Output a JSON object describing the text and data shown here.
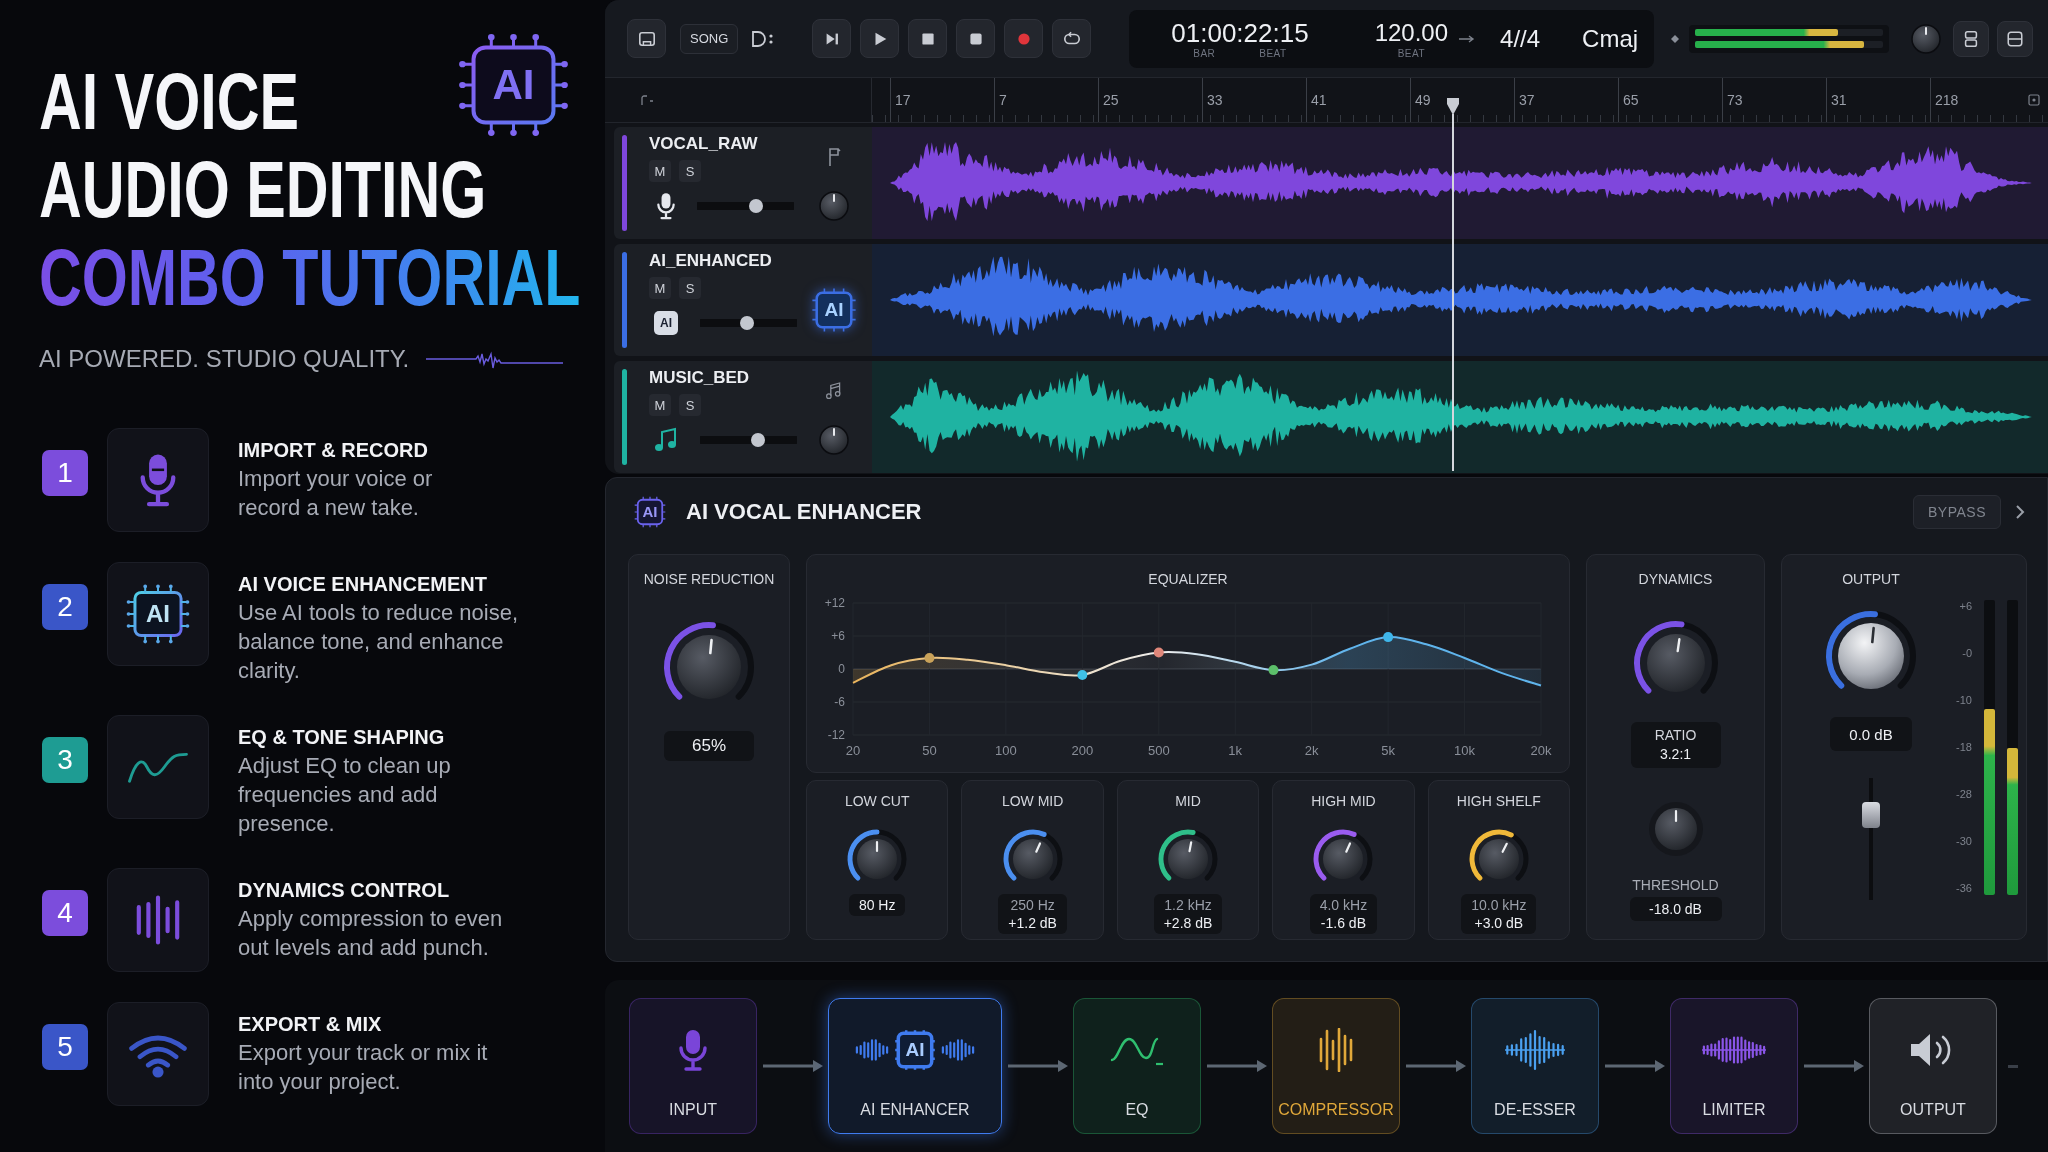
{
  "hero": {
    "chip_text": "AI",
    "title_lines": [
      {
        "text": "AI VOICE",
        "kind": "plain"
      },
      {
        "text": "AUDIO EDITING",
        "kind": "plain"
      },
      {
        "text": "COMBO TUTORIAL",
        "kind": "gradient"
      }
    ],
    "tagline": "AI POWERED. STUDIO QUALITY."
  },
  "steps": [
    {
      "number": "1",
      "color": "#7c4ddc",
      "title": "IMPORT & RECORD",
      "description": "Import your voice or\nrecord a new take."
    },
    {
      "number": "2",
      "color": "#3a56c8",
      "title": "AI VOICE ENHANCEMENT",
      "description": "Use AI tools to reduce noise,\nbalance tone, and enhance\nclarity.",
      "chip_text": "AI"
    },
    {
      "number": "3",
      "color": "#1e9c93",
      "title": "EQ & TONE SHAPING",
      "description": "Adjust EQ to clean up\nfrequencies and add\npresence."
    },
    {
      "number": "4",
      "color": "#7c4ddc",
      "title": "DYNAMICS CONTROL",
      "description": "Apply compression to even\nout levels and add punch."
    },
    {
      "number": "5",
      "color": "#3a56c8",
      "title": "EXPORT & MIX",
      "description": "Export your track or mix it\ninto your project."
    }
  ],
  "toolbar": {
    "mode": "SONG",
    "time": "01:00:22:15",
    "time_units": [
      "BAR",
      "BEAT"
    ],
    "tempo": "120.00",
    "tempo_unit": "BEAT",
    "signature": "4//4",
    "key": "Cmaj",
    "master_meter": [
      {
        "level": 0.76
      },
      {
        "level": 0.9
      }
    ]
  },
  "ruler": {
    "marks": [
      "17",
      "7",
      "25",
      "33",
      "41",
      "49",
      "37",
      "65",
      "73",
      "31",
      "218"
    ]
  },
  "tracks": [
    {
      "name": "VOCAL_RAW",
      "kind": "audio",
      "color": "#7f47dc",
      "buttons": [
        "M",
        "S"
      ],
      "level": 0.63
    },
    {
      "name": "AI_ENHANCED",
      "kind": "ai",
      "color": "#3b6ee4",
      "buttons": [
        "M",
        "S"
      ],
      "level": 0.48,
      "badge_text": "AI",
      "chip_text": "AI"
    },
    {
      "name": "MUSIC_BED",
      "kind": "audio",
      "color": "#1fb3a2",
      "buttons": [
        "M",
        "S"
      ],
      "level": 0.61
    }
  ],
  "enhancer": {
    "icon_text": "AI",
    "title": "AI VOCAL ENHANCER",
    "bypass": "BYPASS",
    "noise_reduction": {
      "label": "NOISE REDUCTION",
      "level": 0.52,
      "value": "65%"
    },
    "equalizer": {
      "title": "EQUALIZER",
      "chart_data": {
        "type": "area",
        "grid": true,
        "categories": [
          "20",
          null,
          "50",
          null,
          "100",
          null,
          "200",
          null,
          "500",
          null,
          "1k",
          null,
          "2k",
          null,
          "5k",
          null,
          "10k",
          null,
          "20k"
        ],
        "series": [
          {
            "color": "#5fb4ec",
            "values": [
              -2.5,
              0.7,
              2,
              1.7,
              0.7,
              -0.6,
              -1.1,
              1.5,
              3,
              2.7,
              1.3,
              -0.2,
              0.8,
              3.7,
              5.8,
              4.5,
              2,
              -0.8,
              -3
            ]
          }
        ],
        "ylim": [
          -12,
          12
        ],
        "yticks": [
          {
            "value": 12,
            "label": "+12"
          },
          {
            "value": 6,
            "label": "+6"
          },
          0,
          -6,
          -12
        ]
      },
      "bands": [
        {
          "label": "LOW CUT",
          "color": "#4b8ff0",
          "level": 0.5,
          "values": [
            "80 Hz"
          ]
        },
        {
          "label": "LOW MID",
          "color": "#4b8ff0",
          "level": 0.59,
          "values": [
            "250 Hz",
            "+1.2 dB"
          ]
        },
        {
          "label": "MID",
          "color": "#2fbf8a",
          "level": 0.54,
          "values": [
            "1.2 kHz",
            "+2.8 dB"
          ]
        },
        {
          "label": "HIGH MID",
          "color": "#9a5cf0",
          "level": 0.59,
          "values": [
            "4.0 kHz",
            "-1.6 dB"
          ]
        },
        {
          "label": "HIGH SHELF",
          "color": "#f0b93a",
          "level": 0.6,
          "values": [
            "10.0 kHz",
            "+3.0 dB"
          ]
        }
      ]
    },
    "dynamics": {
      "title": "DYNAMICS",
      "ratio": {
        "label": "RATIO",
        "value": "3.2:1",
        "level": 0.53
      },
      "threshold": {
        "label": "THRESHOLD",
        "value": "-18.0 dB"
      }
    },
    "output": {
      "title": "OUTPUT",
      "knob": {
        "level": 0.52,
        "value": "0.0 dB"
      },
      "fader": {
        "level": 0.75
      },
      "scale": [
        "+6",
        "-0",
        "-10",
        "-18",
        "-28",
        "-30",
        "-36"
      ],
      "meters": [
        {
          "level": 0.63
        },
        {
          "level": 0.5
        }
      ]
    }
  },
  "chain": {
    "nodes": [
      {
        "label": "INPUT",
        "color": "#7a45d8",
        "selected": false,
        "highlighted": false
      },
      {
        "label": "AI ENHANCER",
        "color": "#3f7bef",
        "selected": true,
        "highlighted": false,
        "chip_text": "AI"
      },
      {
        "label": "EQ",
        "color": "#2fbf6f",
        "selected": false,
        "highlighted": false
      },
      {
        "label": "COMPRESSOR",
        "color": "#e0a83a",
        "selected": false,
        "highlighted": true
      },
      {
        "label": "DE-ESSER",
        "color": "#4aa0f0",
        "selected": false,
        "highlighted": false
      },
      {
        "label": "LIMITER",
        "color": "#8a55e8",
        "selected": false,
        "highlighted": false
      },
      {
        "label": "OUTPUT",
        "color": "#c8ccd4",
        "selected": false,
        "highlighted": false
      }
    ]
  }
}
